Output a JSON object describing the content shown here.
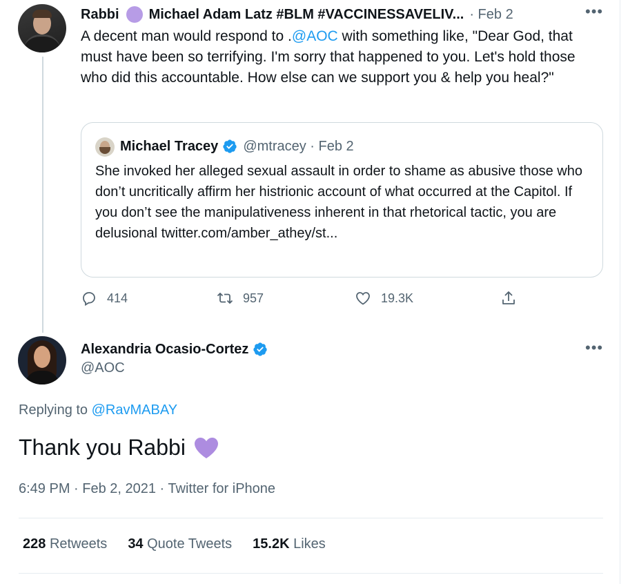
{
  "parent_tweet": {
    "display_name_start": "Rabbi",
    "display_name_end": "Michael Adam Latz #BLM #VACCINESSAVELIV...",
    "date": "· Feb 2",
    "more_icon": "more-horizontal-icon",
    "text_before": "A decent man would respond to .",
    "mention": "@AOC",
    "text_after": " with something like, \"Dear God, that must have been so terrifying. I'm sorry that happened to you. Let's hold those who did this accountable. How else can we support you & help you heal?\"",
    "purple_circle_color": "#b79ce6"
  },
  "quote_tweet": {
    "name": "Michael Tracey",
    "handle_date": "@mtracey · Feb 2",
    "text": "She invoked her alleged sexual assault in order to shame as abusive those who don’t uncritically affirm her histrionic account of what occurred at the Capitol. If you don’t see the manipulativeness inherent in that rhetorical tactic, you are delusional twitter.com/amber_athey/st..."
  },
  "actions": {
    "reply_count": "414",
    "retweet_count": "957",
    "like_count": "19.3K"
  },
  "main_tweet": {
    "name": "Alexandria Ocasio-Cortez",
    "handle": "@AOC",
    "replying_prefix": "Replying to ",
    "replying_to": "@RavMABAY",
    "text": "Thank you Rabbi",
    "emoji": "purple-heart",
    "timestamp": "6:49 PM · Feb 2, 2021 · Twitter for iPhone"
  },
  "stats": {
    "retweets_count": "228",
    "retweets_label": "Retweets",
    "quotes_count": "34",
    "quotes_label": "Quote Tweets",
    "likes_count": "15.2K",
    "likes_label": "Likes"
  },
  "colors": {
    "link": "#1d9bf0",
    "muted": "#536471",
    "verified": "#1d9bf0",
    "purple": "#b79ce6"
  }
}
